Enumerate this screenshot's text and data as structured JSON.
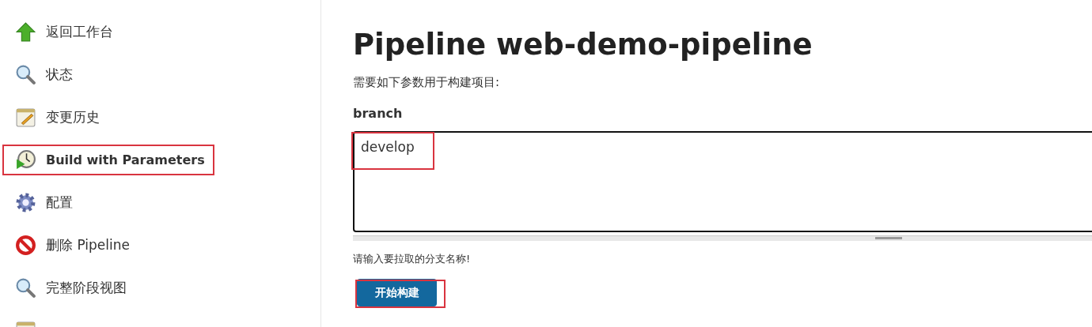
{
  "sidebar": {
    "items": [
      {
        "kind": "back",
        "label": "返回工作台",
        "highlighted": false
      },
      {
        "kind": "search",
        "label": "状态",
        "highlighted": false
      },
      {
        "kind": "notepad",
        "label": "变更历史",
        "highlighted": false
      },
      {
        "kind": "build",
        "label": "Build with Parameters",
        "highlighted": true
      },
      {
        "kind": "gear",
        "label": "配置",
        "highlighted": false
      },
      {
        "kind": "delete",
        "label": "删除 Pipeline",
        "highlighted": false
      },
      {
        "kind": "search",
        "label": "完整阶段视图",
        "highlighted": false
      },
      {
        "kind": "notepad",
        "highlighted": false
      }
    ]
  },
  "main": {
    "title": "Pipeline web-demo-pipeline",
    "subtitle": "需要如下参数用于构建项目:",
    "parameter": {
      "name": "branch",
      "value": "develop",
      "value_highlighted": true,
      "description": "请输入要拉取的分支名称!"
    },
    "build_button": {
      "label": "开始构建",
      "highlighted": true
    }
  }
}
